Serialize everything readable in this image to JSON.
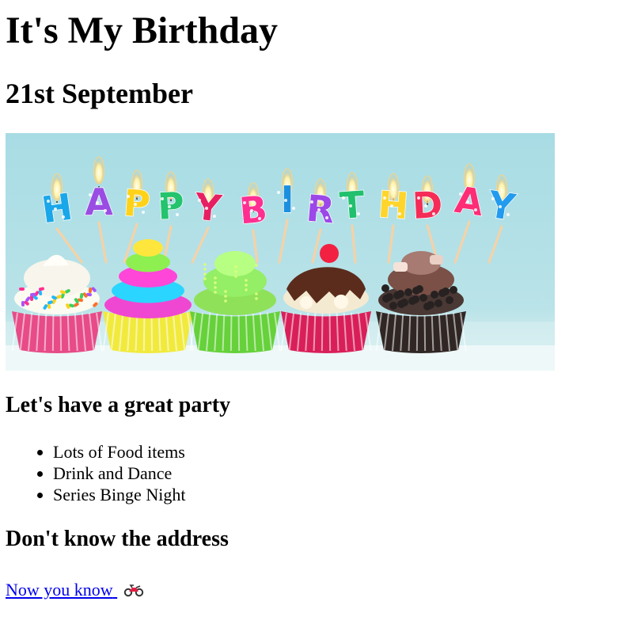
{
  "page": {
    "title": "It's My Birthday",
    "date": "21st September"
  },
  "banner": {
    "letters": [
      "H",
      "A",
      "P",
      "P",
      "Y",
      "B",
      "I",
      "R",
      "T",
      "H",
      "D",
      "A",
      "Y"
    ],
    "letter_colors": [
      "#1aa7ea",
      "#9a4de3",
      "#ffd21a",
      "#24c36d",
      "#e61f62",
      "#ff2f91",
      "#1c90df",
      "#9c47e8",
      "#21c06e",
      "#ffd52b",
      "#f42c57",
      "#ff2d75",
      "#229bee"
    ],
    "cupcakes": [
      {
        "name": "cupcake-white-sprinkles",
        "frosting": "#f7f7ef",
        "liner": "#e74b88",
        "top": "#ffe0f0"
      },
      {
        "name": "cupcake-rainbow",
        "frosting": "#ef52d2",
        "liner": "#f1ea3d",
        "top": "#f6f04c"
      },
      {
        "name": "cupcake-green",
        "frosting": "#7ee551",
        "liner": "#66d13b",
        "top": "#9cff76"
      },
      {
        "name": "cupcake-chocolate-cherry",
        "frosting": "#5b2c1c",
        "liner": "#d91f5a",
        "top": "#f7f0e0"
      },
      {
        "name": "cupcake-chocolate",
        "frosting": "#7b4f43",
        "liner": "#302725",
        "top": "#b48b83"
      }
    ]
  },
  "party": {
    "heading": "Let's have a great party",
    "items": [
      "Lots of Food items",
      "Drink and Dance",
      "Series Binge Night"
    ]
  },
  "address": {
    "heading": "Don't know the address",
    "link_text": "Now you know",
    "icon": "motorcycle-icon",
    "link_color": "#0000ee"
  }
}
